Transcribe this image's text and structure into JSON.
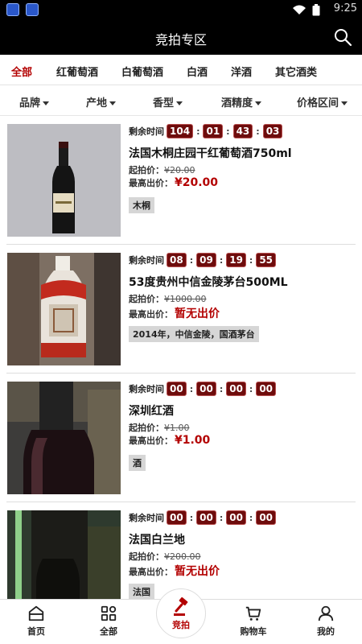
{
  "status_bar": {
    "time": "9:25",
    "icons": [
      "wifi-icon",
      "battery-icon"
    ]
  },
  "app_bar": {
    "title": "竞拍专区",
    "search_icon": "search-icon"
  },
  "categories": [
    {
      "label": "全部",
      "active": true
    },
    {
      "label": "红葡萄酒",
      "active": false
    },
    {
      "label": "白葡萄酒",
      "active": false
    },
    {
      "label": "白酒",
      "active": false
    },
    {
      "label": "洋酒",
      "active": false
    },
    {
      "label": "其它酒类",
      "active": false
    }
  ],
  "filters": [
    {
      "label": "品牌"
    },
    {
      "label": "产地"
    },
    {
      "label": "香型"
    },
    {
      "label": "酒精度"
    },
    {
      "label": "价格区间"
    }
  ],
  "labels": {
    "remaining": "剩余时间",
    "start_price": "起拍价：",
    "highest_bid": "最高出价："
  },
  "items": [
    {
      "countdown": [
        "104",
        "01",
        "43",
        "03"
      ],
      "name": "法国木桐庄园干红葡萄酒750ml",
      "start_price": "¥20.00",
      "highest_bid": "¥20.00",
      "tag": "木桐"
    },
    {
      "countdown": [
        "08",
        "09",
        "19",
        "55"
      ],
      "name": "53度贵州中信金陵茅台500ML",
      "start_price": "¥1000.00",
      "highest_bid": "暂无出价",
      "tag": "2014年，中信金陵，国酒茅台"
    },
    {
      "countdown": [
        "00",
        "00",
        "00",
        "00"
      ],
      "name": "深圳红酒",
      "start_price": "¥1.00",
      "highest_bid": "¥1.00",
      "tag": "酒"
    },
    {
      "countdown": [
        "00",
        "00",
        "00",
        "00"
      ],
      "name": "法国白兰地",
      "start_price": "¥200.00",
      "highest_bid": "暂无出价",
      "tag": "法国"
    }
  ],
  "tab_bar": [
    {
      "label": "首页",
      "icon": "home-icon"
    },
    {
      "label": "全部",
      "icon": "grid-icon"
    },
    {
      "label": "竞拍",
      "icon": "gavel-icon",
      "active": true
    },
    {
      "label": "购物车",
      "icon": "cart-icon"
    },
    {
      "label": "我的",
      "icon": "user-icon"
    }
  ],
  "colors": {
    "accent": "#b30000",
    "countdown_bg": "#6e0c0c",
    "header_bg": "#000000"
  }
}
